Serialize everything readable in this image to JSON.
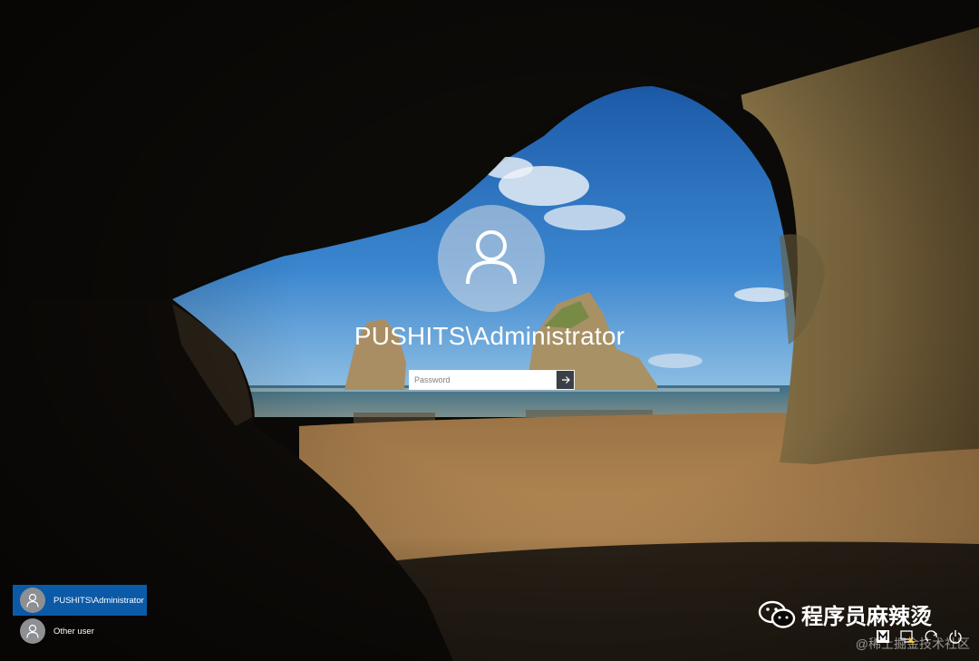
{
  "login": {
    "username": "PUSHITS\\Administrator",
    "password_placeholder": "Password"
  },
  "user_list": [
    {
      "label": "PUSHITS\\Administrator",
      "selected": true
    },
    {
      "label": "Other user",
      "selected": false
    }
  ],
  "watermark": {
    "primary": "程序员麻辣烫",
    "secondary": "@稀土掘金技术社区"
  },
  "icons": {
    "submit": "arrow-right-icon",
    "avatar": "user-icon",
    "status": [
      "input-method-icon",
      "network-icon",
      "ease-of-access-icon",
      "power-icon"
    ]
  },
  "colors": {
    "selected_user": "#0a5aa8",
    "sky": "#2f78c4",
    "sand": "#b68a55"
  }
}
